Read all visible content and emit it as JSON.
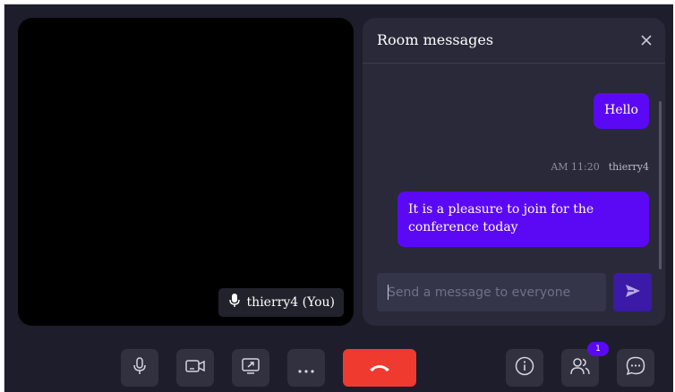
{
  "participant": {
    "name_label": "thierry4 (You)"
  },
  "chat": {
    "title": "Room messages",
    "messages": [
      {
        "text": "Hello"
      },
      {
        "time": "AM 11:20",
        "sender": "thierry4",
        "text": "It is a pleasure to join for the conference today"
      }
    ],
    "input_placeholder": "Send a message to everyone"
  },
  "toolbar": {
    "participants_badge": "1"
  },
  "colors": {
    "background": "#1d1d2b",
    "panel": "#292939",
    "accent": "#5b09f5",
    "end_call": "#ef3a2f",
    "button": "#31313f"
  },
  "icons": {
    "close": "close-icon",
    "send": "send-icon",
    "microphone": "microphone-icon",
    "camera": "camera-icon",
    "screen_share": "screen-share-icon",
    "more": "more-icon",
    "end_call": "phone-hangup-icon",
    "info": "info-icon",
    "participants": "people-icon",
    "chat": "chat-icon"
  }
}
